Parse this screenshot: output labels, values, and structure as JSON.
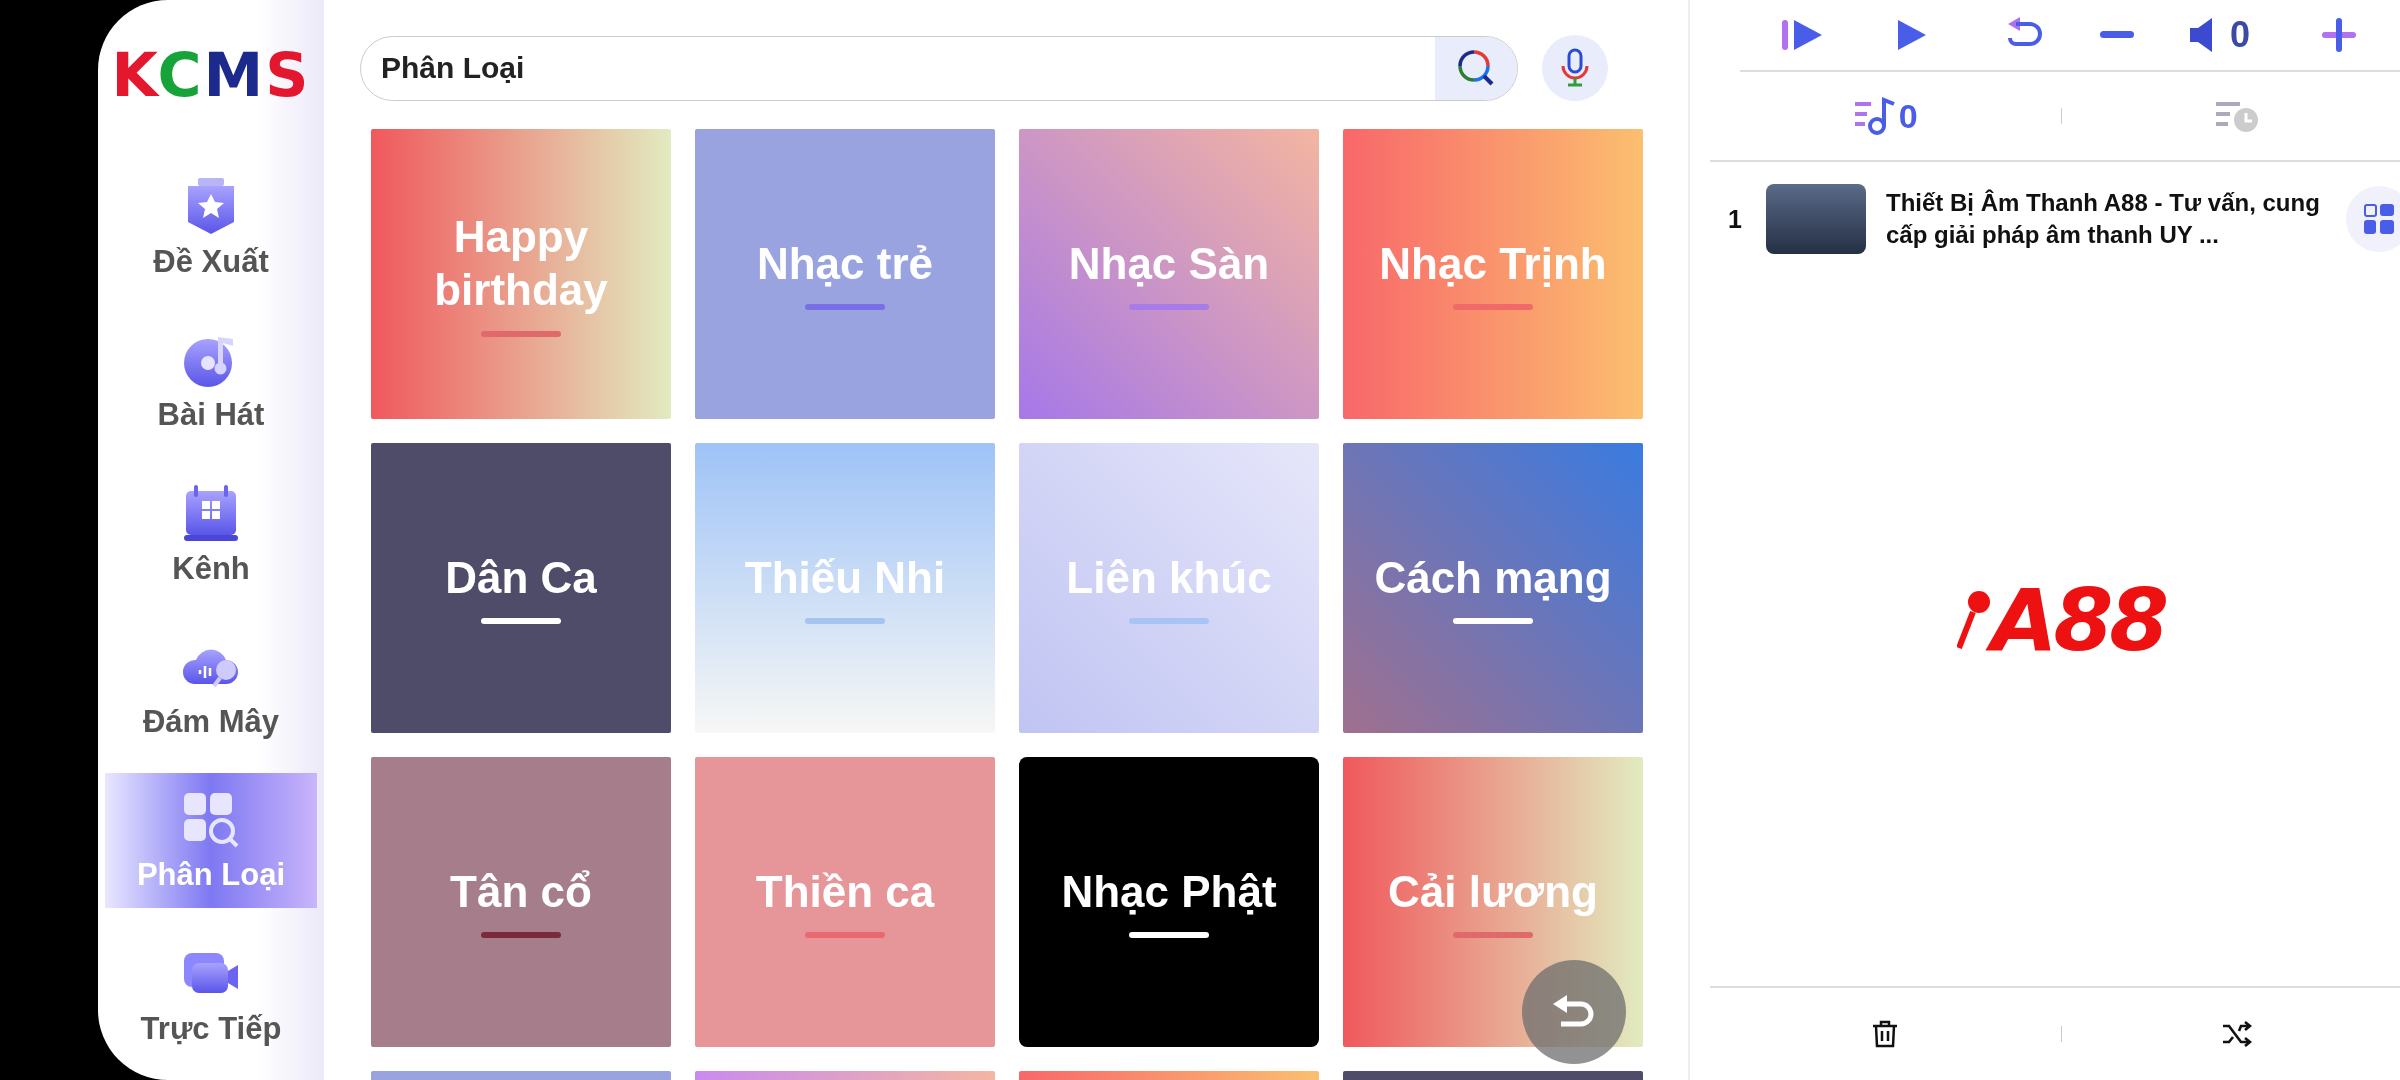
{
  "sidebar": {
    "logo": [
      {
        "text": "K",
        "color": "#e3172d"
      },
      {
        "text": "C",
        "color": "#16a33a"
      },
      {
        "text": "M",
        "color": "#1b2a8c"
      },
      {
        "text": "S",
        "color": "#e3172d"
      }
    ],
    "items": [
      {
        "label": "Đề Xuất",
        "kind": "badge",
        "selected": false
      },
      {
        "label": "Bài Hát",
        "kind": "disc",
        "selected": false
      },
      {
        "label": "Kênh",
        "kind": "calendar",
        "selected": false
      },
      {
        "label": "Đám Mây",
        "kind": "cloud",
        "selected": false
      },
      {
        "label": "Phân Loại",
        "kind": "grid",
        "selected": true
      },
      {
        "label": "Trực Tiếp",
        "kind": "camera",
        "selected": false
      }
    ]
  },
  "search": {
    "value": "Phân Loại"
  },
  "categories": [
    {
      "label": "Happy birthday",
      "kind": "blush"
    },
    {
      "label": "Nhạc trẻ",
      "kind": "periwinkle"
    },
    {
      "label": "Nhạc Sàn",
      "kind": "violet"
    },
    {
      "label": "Nhạc Trịnh",
      "kind": "coral"
    },
    {
      "label": "Dân Ca",
      "kind": "slate"
    },
    {
      "label": "Thiếu Nhi",
      "kind": "sky"
    },
    {
      "label": "Liên khúc",
      "kind": "lavender"
    },
    {
      "label": "Cách mạng",
      "kind": "dusk"
    },
    {
      "label": "Tân cổ",
      "kind": "mauve"
    },
    {
      "label": "Thiền ca",
      "kind": "rose"
    },
    {
      "label": "Nhạc Phật",
      "kind": "black"
    },
    {
      "label": "Cải lương",
      "kind": "blush"
    },
    {
      "kind": "periwinkle"
    },
    {
      "kind": "orchid"
    },
    {
      "kind": "coral"
    },
    {
      "kind": "slate"
    }
  ],
  "player": {
    "volume": "0"
  },
  "queue_tabs": [
    {
      "kind": "queue",
      "count": "0",
      "selected": true
    },
    {
      "kind": "history",
      "selected": false
    }
  ],
  "queue": [
    {
      "index": "1",
      "title": "Thiết Bị Âm Thanh A88 - Tư vấn, cung cấp giải pháp âm thanh UY ..."
    }
  ],
  "brand": {
    "text": "A88"
  }
}
